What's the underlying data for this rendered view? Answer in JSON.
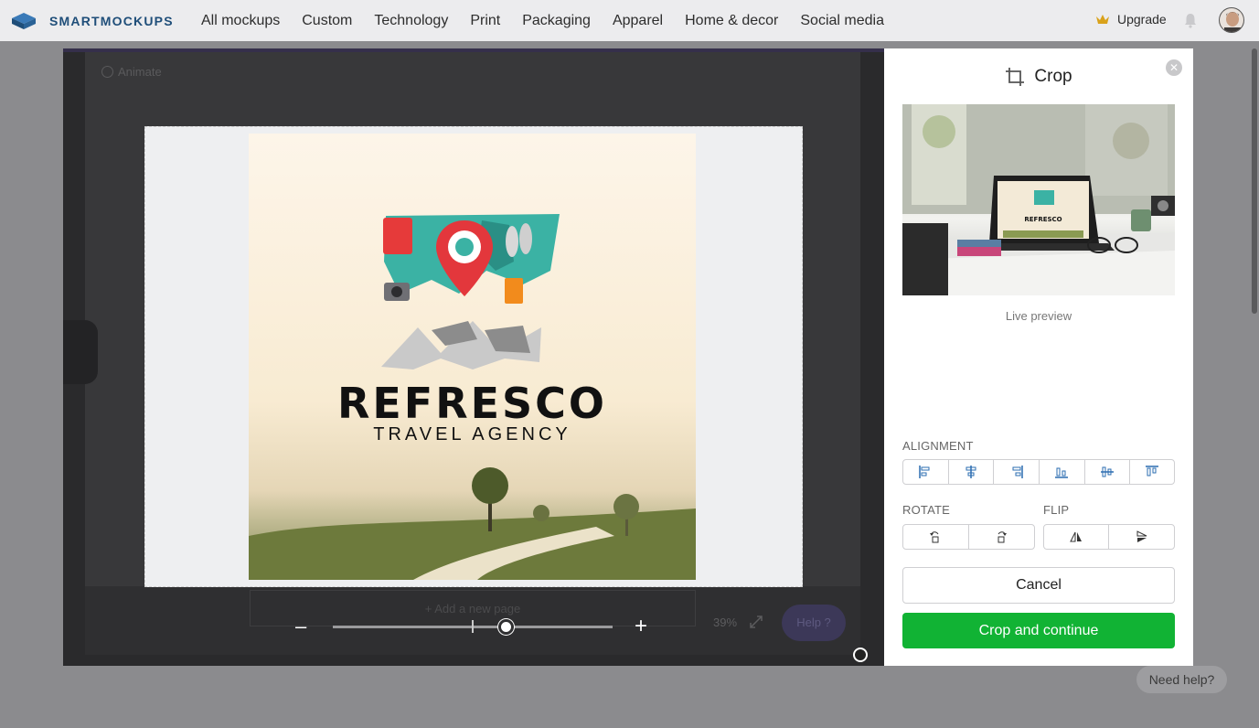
{
  "header": {
    "brand": "SMARTMOCKUPS",
    "nav": [
      "All mockups",
      "Custom",
      "Technology",
      "Print",
      "Packaging",
      "Apparel",
      "Home & decor",
      "Social media"
    ],
    "upgrade_label": "Upgrade"
  },
  "editor": {
    "animate_label": "Animate",
    "add_page_label": "+ Add a new page",
    "zoom_level": "39%",
    "zoom_fraction": 0.62,
    "help_label": "Help ?",
    "design": {
      "title": "REFRESCO",
      "subtitle": "TRAVEL AGENCY"
    }
  },
  "crop_panel": {
    "title": "Crop",
    "preview_label": "Live preview",
    "alignment_label": "ALIGNMENT",
    "rotate_label": "ROTATE",
    "flip_label": "FLIP",
    "cancel_label": "Cancel",
    "confirm_label": "Crop and continue",
    "accent_color": "#11b334"
  },
  "need_help_label": "Need help?"
}
